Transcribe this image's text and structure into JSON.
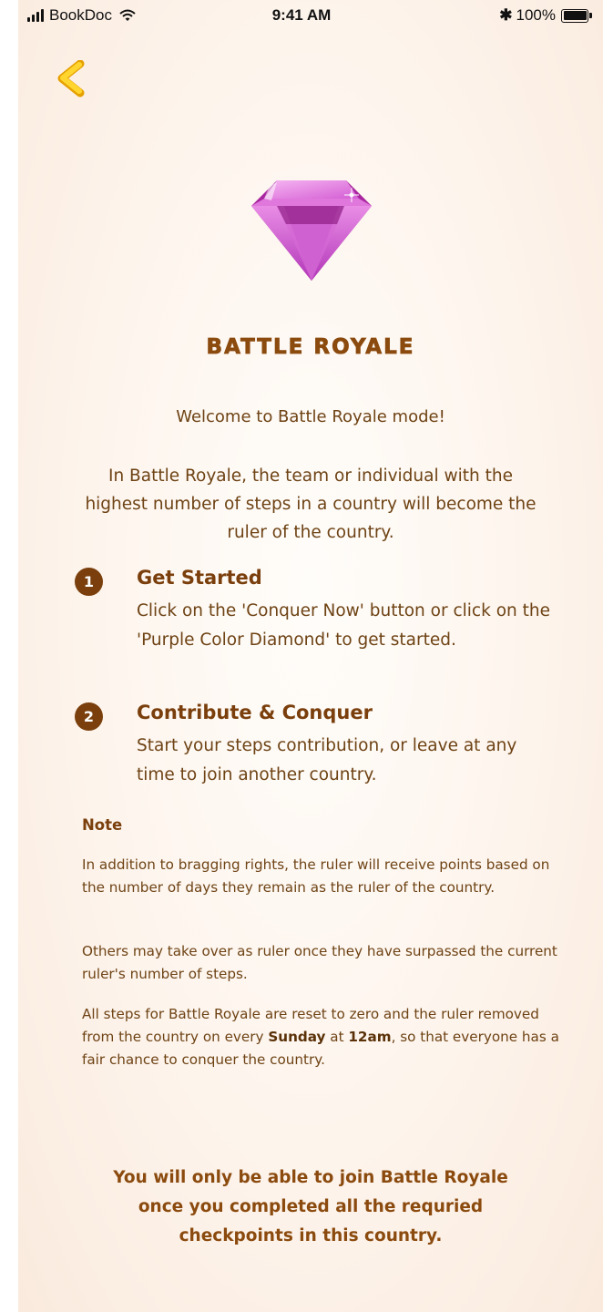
{
  "status_bar": {
    "carrier": "BookDoc",
    "time": "9:41 AM",
    "bluetooth": "✱",
    "battery": "100%",
    "icons": [
      "signal-icon",
      "wifi-icon",
      "bluetooth-icon",
      "battery-icon"
    ]
  },
  "header": {
    "back_icon": "back-arrow-icon",
    "back_color": "#f5c518"
  },
  "hero": {
    "icon": "purple-diamond-icon",
    "diamond_color": "#c94fd0",
    "title": "BATTLE ROYALE",
    "welcome": "Welcome to Battle Royale mode!",
    "intro": "In Battle Royale, the team or individual with the highest number of steps in a country will become the ruler of the country."
  },
  "steps": [
    {
      "number": "1",
      "title": "Get Started",
      "description": "Click on the 'Conquer Now' button or click on the 'Purple Color Diamond' to get started."
    },
    {
      "number": "2",
      "title": "Contribute & Conquer",
      "description": "Start your steps contribution, or leave at any time to join another country."
    }
  ],
  "note": {
    "heading": "Note",
    "paragraph_1": "In addition to bragging rights, the ruler will receive points based on the number of days they remain as the ruler of the country.",
    "paragraph_2": "Others may take over as ruler once they have surpassed the current ruler's number of steps.",
    "paragraph_3_before": "All steps for Battle Royale are reset to zero and the ruler removed from the country on every ",
    "paragraph_3_day": "Sunday",
    "paragraph_3_mid": " at ",
    "paragraph_3_time": "12am",
    "paragraph_3_after": ", so that everyone has a fair chance to conquer the country."
  },
  "footer_message": "You will only be able to join Battle Royale once you completed all the requried checkpoints in this country.",
  "colors": {
    "brown_dark": "#7a3f0c",
    "brown_text": "#6e4315",
    "background": "#fdf4ec"
  }
}
